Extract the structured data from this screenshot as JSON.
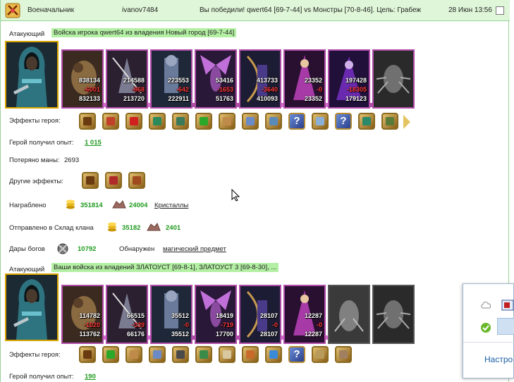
{
  "header": {
    "rank": "Военачальник",
    "player": "ivanov7484",
    "result": "Вы победили! qwert64 [69-7-44] vs Монстры [70-8-46]. Цель: Грабеж",
    "datetime": "28 Июн 13:56"
  },
  "battle1": {
    "attacker_label": "Атакующий",
    "attacker_text": "Войска игрока qwert64 из владения Новый город [69-7-44]",
    "units": [
      {
        "total": "838134",
        "lost": "-6001",
        "left": "832133"
      },
      {
        "total": "214588",
        "lost": "-868",
        "left": "213720"
      },
      {
        "total": "223553",
        "lost": "-642",
        "left": "222911"
      },
      {
        "total": "53416",
        "lost": "-1653",
        "left": "51763"
      },
      {
        "total": "413733",
        "lost": "-3640",
        "left": "410093"
      },
      {
        "total": "23352",
        "lost": "-0",
        "left": "23352"
      },
      {
        "total": "197428",
        "lost": "-18305",
        "left": "179123"
      }
    ],
    "effects_label": "Эффекты героя:",
    "exp_label": "Герой получил опыт:",
    "exp_value": "1 015",
    "mana_label": "Потеряно маны:",
    "mana_value": "2693",
    "other_label": "Другие эффекты:",
    "loot_label": "Награблено",
    "loot_gold": "351814",
    "loot_crystals": "24004",
    "loot_crystals_link": "Кристаллы",
    "sent_label": "Отправлено в Склад клана",
    "sent_gold": "35182",
    "sent_crystals": "2401",
    "gifts_label": "Дары богов",
    "gifts_value": "10792",
    "found_label": "Обнаружен",
    "found_link": "магический предмет"
  },
  "battle2": {
    "attacker_label": "Атакующий",
    "attacker_text": "Ваши войска из владений ЗЛАТОУСТ [69-8-1], ЗЛАТОУСТ 3 [69-8-30], ...",
    "units": [
      {
        "total": "114782",
        "lost": "-1020",
        "left": "113762"
      },
      {
        "total": "66515",
        "lost": "-339",
        "left": "66176"
      },
      {
        "total": "35512",
        "lost": "-0",
        "left": "35512"
      },
      {
        "total": "18419",
        "lost": "-719",
        "left": "17700"
      },
      {
        "total": "28107",
        "lost": "-0",
        "left": "28107"
      },
      {
        "total": "12287",
        "lost": "-0",
        "left": "12287"
      }
    ],
    "effects_label": "Эффекты героя:",
    "exp_label": "Герой получил опыт:",
    "exp_value": "190"
  },
  "popup": {
    "settings_text": "Настро"
  },
  "icons": {
    "unit_frame_color": "#b04ca8",
    "hero_frame_color": "#d9a400",
    "value_green": "#1f9a1f",
    "loss_red": "#ff3a3a",
    "header_bg": "#dff6d8",
    "highlight_bg": "#b4f0a4"
  }
}
